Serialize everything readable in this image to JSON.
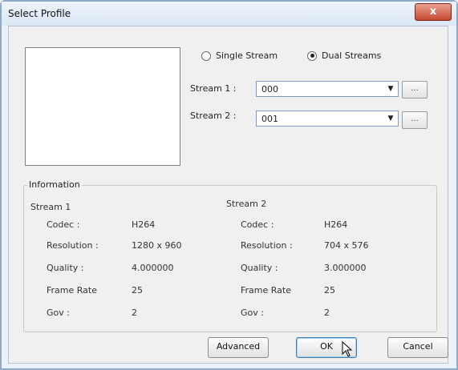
{
  "window": {
    "title": "Select Profile",
    "close_label": "x"
  },
  "mode": {
    "single_label": "Single Stream",
    "dual_label": "Dual Streams",
    "selected": "dual"
  },
  "streams": {
    "stream1_label": "Stream 1 :",
    "stream1_value": "000",
    "stream2_label": "Stream 2 :",
    "stream2_value": "001",
    "browse_label": "..."
  },
  "info": {
    "group_title": "Information",
    "stream1": {
      "header": "Stream 1",
      "rows": [
        {
          "label": "Codec :",
          "value": "H264"
        },
        {
          "label": "Resolution :",
          "value": "1280 x 960"
        },
        {
          "label": "Quality :",
          "value": "4.000000"
        },
        {
          "label": "Frame Rate",
          "value": "25"
        },
        {
          "label": "Gov :",
          "value": "2"
        }
      ]
    },
    "stream2": {
      "header": "Stream 2",
      "rows": [
        {
          "label": "Codec :",
          "value": "H264"
        },
        {
          "label": "Resolution :",
          "value": "704 x 576"
        },
        {
          "label": "Quality :",
          "value": "3.000000"
        },
        {
          "label": "Frame Rate",
          "value": "25"
        },
        {
          "label": "Gov :",
          "value": "2"
        }
      ]
    }
  },
  "buttons": {
    "advanced": "Advanced",
    "ok": "OK",
    "cancel": "Cancel"
  }
}
